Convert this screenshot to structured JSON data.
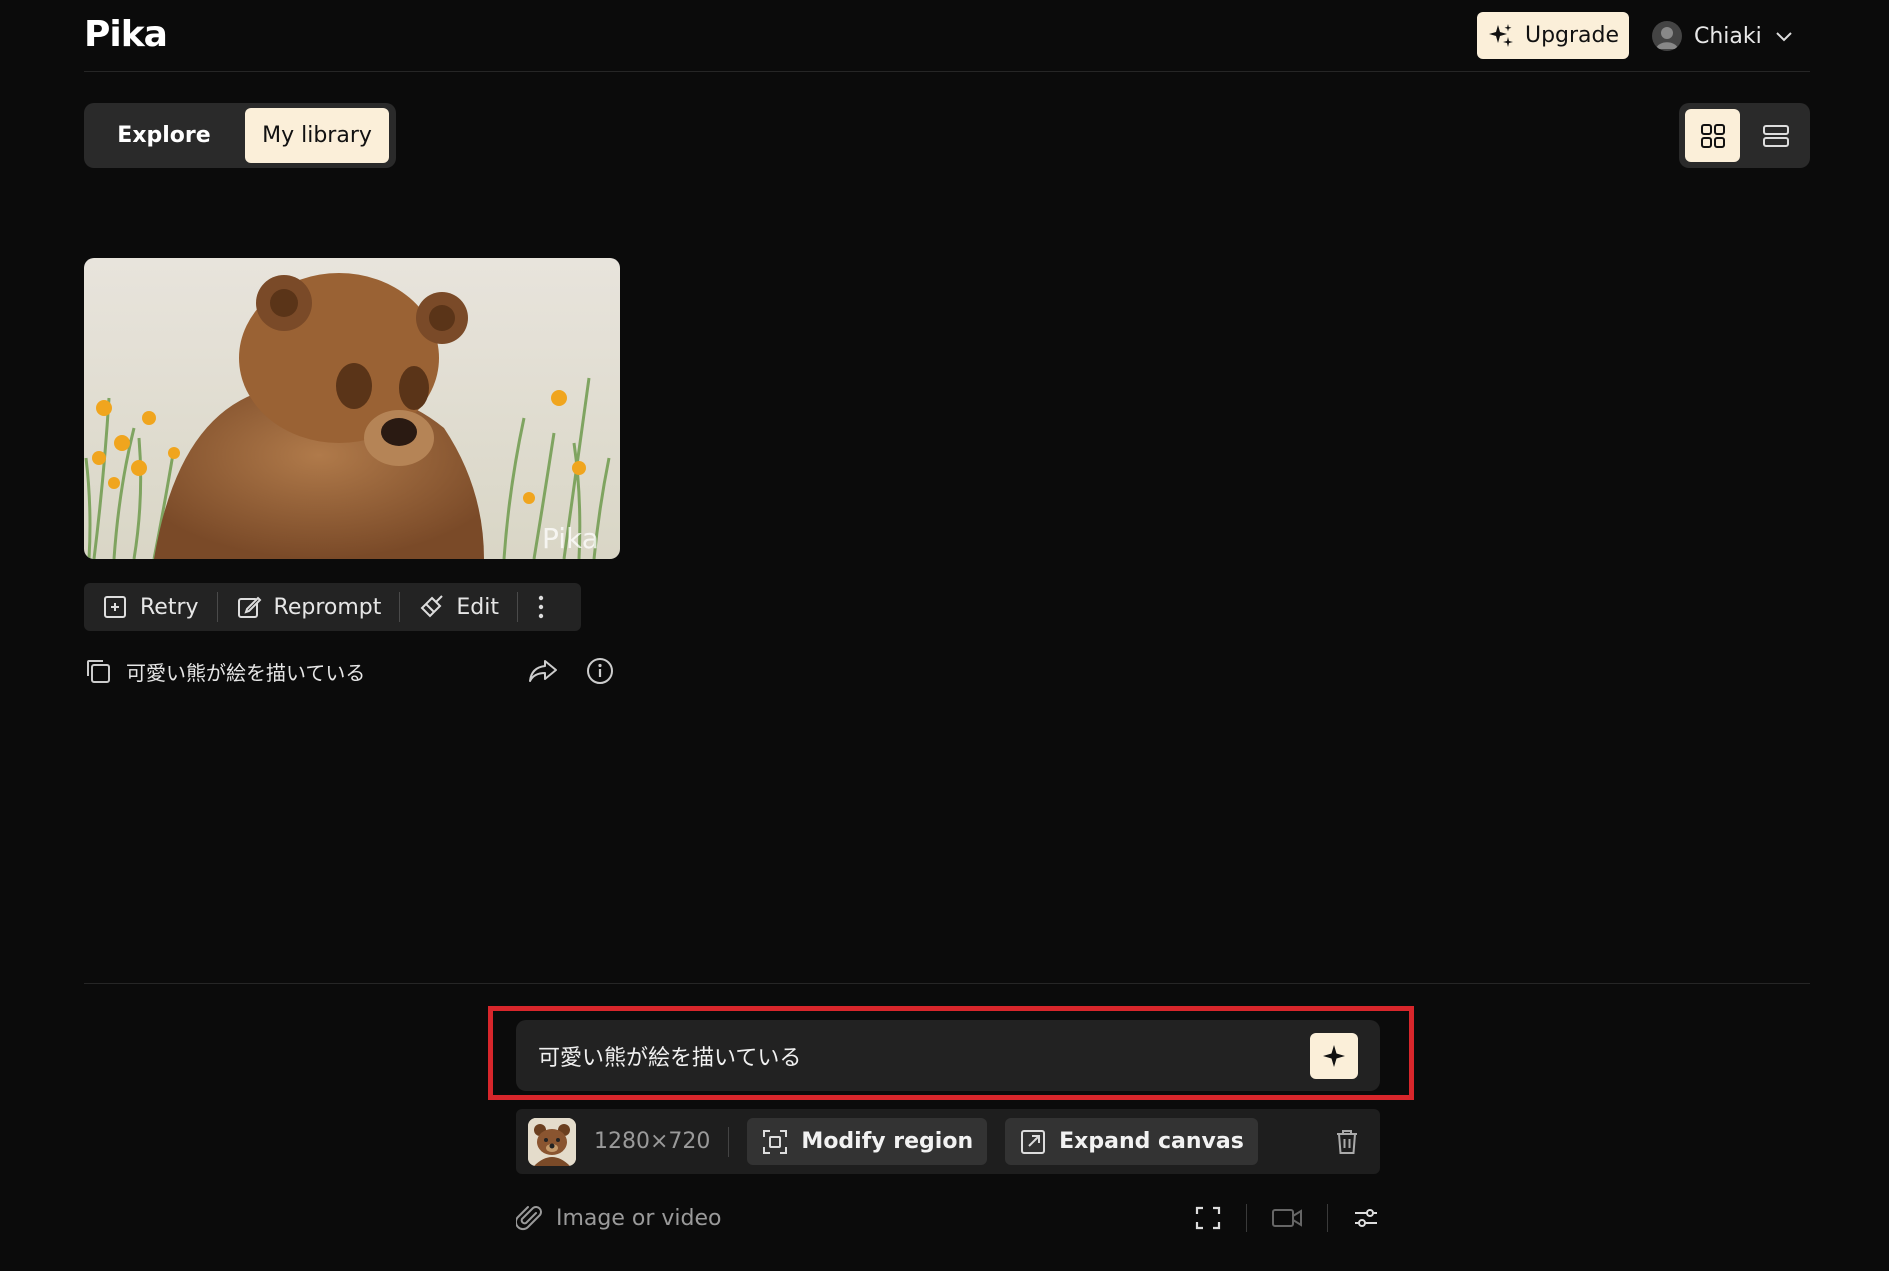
{
  "header": {
    "logo": "Pika",
    "upgrade_label": "Upgrade",
    "user_name": "Chiaki"
  },
  "tabs": [
    {
      "label": "Explore",
      "active": false
    },
    {
      "label": "My library",
      "active": true
    }
  ],
  "view_toggle": {
    "active": "grid-view",
    "options": [
      "grid-view-icon",
      "list-view-icon"
    ]
  },
  "card": {
    "watermark": "Pika",
    "actions": {
      "retry": "Retry",
      "reprompt": "Reprompt",
      "edit": "Edit"
    },
    "prompt_caption": "可愛い熊が絵を描いている"
  },
  "composer": {
    "prompt_value": "可愛い熊が絵を描いている",
    "resolution": "1280×720",
    "modify_region_label": "Modify region",
    "expand_canvas_label": "Expand canvas",
    "attach_placeholder": "Image or video"
  },
  "colors": {
    "background": "#0b0b0b",
    "accent": "#fbefd9",
    "highlight": "#d8262b"
  }
}
